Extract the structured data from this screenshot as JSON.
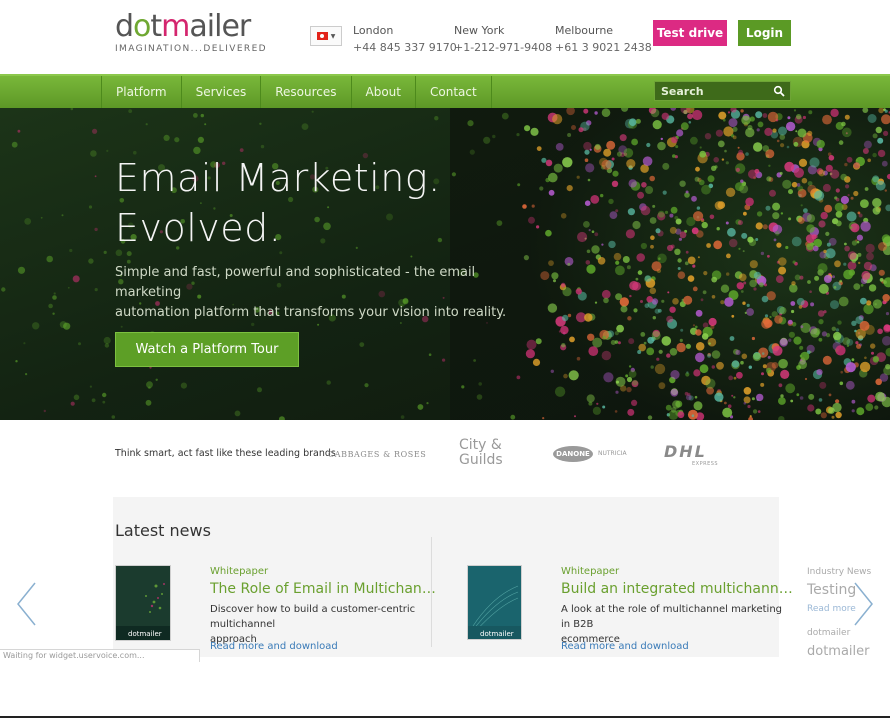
{
  "header": {
    "logo_word_gray1": "d",
    "logo_word_green": "o",
    "logo_word_gray2": "t",
    "logo_word_magenta": "m",
    "logo_word_gray3": "ailer",
    "logo_tagline": "IMAGINATION...DELIVERED",
    "flag_icon": "tunisia-flag-icon",
    "offices": [
      {
        "city": "London",
        "phone": "+44 845 337 9170"
      },
      {
        "city": "New York",
        "phone": "+1-212-971-9408"
      },
      {
        "city": "Melbourne",
        "phone": "+61 3 9021 2438"
      }
    ],
    "test_drive_label": "Test drive",
    "login_label": "Login",
    "colors": {
      "accent_pink": "#dc2a83",
      "accent_green": "#5b9a25"
    }
  },
  "nav": {
    "items": [
      "Platform",
      "Services",
      "Resources",
      "About",
      "Contact"
    ],
    "search_placeholder": "Search",
    "search_icon": "search-icon"
  },
  "hero": {
    "title_line1": "Email Marketing.",
    "title_line2": "Evolved.",
    "subtitle_line1": "Simple and fast, powerful and sophisticated - the email marketing",
    "subtitle_line2": "automation platform that transforms your vision into reality.",
    "cta_label": "Watch a Platform Tour"
  },
  "brands": {
    "intro": "Think smart, act fast like these leading brands",
    "logos": [
      "CABBAGES & ROSES",
      "City & Guilds",
      "DANONE",
      "NUTRICIA",
      "DHL",
      "EXPRESS"
    ]
  },
  "news": {
    "title": "Latest news",
    "cards": [
      {
        "category": "Whitepaper",
        "headline": "The Role of Email in Multichannel ...",
        "desc_line1": "Discover how to build a customer-centric multichannel",
        "desc_line2": "approach",
        "link": "Read more and download",
        "thumb_label": "dotmailer"
      },
      {
        "category": "Whitepaper",
        "headline": "Build an integrated multichannel s...",
        "desc_line1": "A look at the role of multichannel marketing in B2B",
        "desc_line2": "ecommerce",
        "link": "Read more and download",
        "thumb_label": "dotmailer"
      }
    ],
    "peek": {
      "category": "Industry News",
      "headline": "Testing",
      "link": "Read more",
      "brand": "dotmailer",
      "brand2": "dotmailer"
    },
    "prev_icon": "chevron-left-icon",
    "next_icon": "chevron-right-icon"
  },
  "status": {
    "text": "Waiting for widget.uservoice.com..."
  }
}
